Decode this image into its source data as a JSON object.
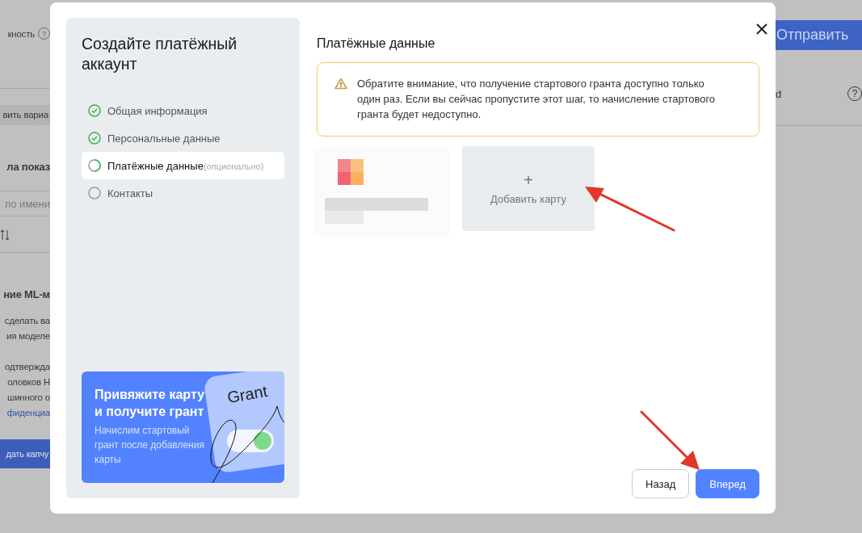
{
  "background_page": {
    "left_fragments": [
      {
        "kind": "label_help",
        "text": "кность"
      },
      {
        "kind": "chip",
        "text": "вить вариа"
      },
      {
        "kind": "heading",
        "text": "ла показ"
      },
      {
        "kind": "search",
        "placeholder": "по имени"
      },
      {
        "kind": "sort_icon"
      },
      {
        "kind": "heading",
        "text": "ние ML-м"
      },
      {
        "kind": "text",
        "text": "сделать ва"
      },
      {
        "kind": "text",
        "text": "ия моделе"
      },
      {
        "kind": "gap"
      },
      {
        "kind": "text",
        "text": "одтвержда"
      },
      {
        "kind": "text",
        "text": "оловков Н"
      },
      {
        "kind": "text",
        "text": "шинного о"
      },
      {
        "kind": "link",
        "text": "фиденциа"
      },
      {
        "kind": "button",
        "text": "дать капчу"
      }
    ],
    "send_button": "Отправить",
    "right_label": "d",
    "help_icon": "?"
  },
  "dialog": {
    "title": "Создайте платёжный аккаунт",
    "steps": [
      {
        "label": "Общая информация",
        "done": true,
        "selected": false
      },
      {
        "label": "Персональные данные",
        "done": true,
        "selected": false
      },
      {
        "label": "Платёжные данные",
        "hint": "(опционально)",
        "done": false,
        "selected": true
      },
      {
        "label": "Контакты",
        "done": false,
        "selected": false
      }
    ],
    "promo": {
      "title": "Привяжите карту и получите грант",
      "text": "Начислим стартовый грант после добавления карты",
      "illustration_word": "Grant"
    },
    "section_title": "Платёжные данные",
    "warning": "Обратите внимание, что получение стартового гранта доступно только один раз. Если вы сейчас пропустите этот шаг, то начисление стартового гранта будет недоступно.",
    "add_card": {
      "icon": "+",
      "label": "Добавить карту"
    },
    "buttons": [
      {
        "label": "Назад",
        "kind": "secondary"
      },
      {
        "label": "Вперед",
        "kind": "primary"
      }
    ]
  }
}
